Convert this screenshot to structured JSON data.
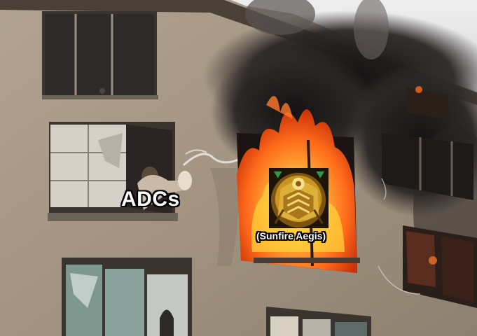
{
  "captions": {
    "adcs": "ADCs",
    "item": "(Sunfire Aegis)"
  },
  "icons": {
    "item_icon": "sunfire-aegis-icon",
    "person_icon": "person-icon"
  },
  "colors": {
    "facade": "#a89a88",
    "smoke": "#1c1a1a",
    "fire_orange": "#ff6a1a",
    "fire_yellow": "#ffd23a",
    "caption_text": "#ffffff",
    "caption_outline": "#000000",
    "item_gold": "#c9951f"
  }
}
